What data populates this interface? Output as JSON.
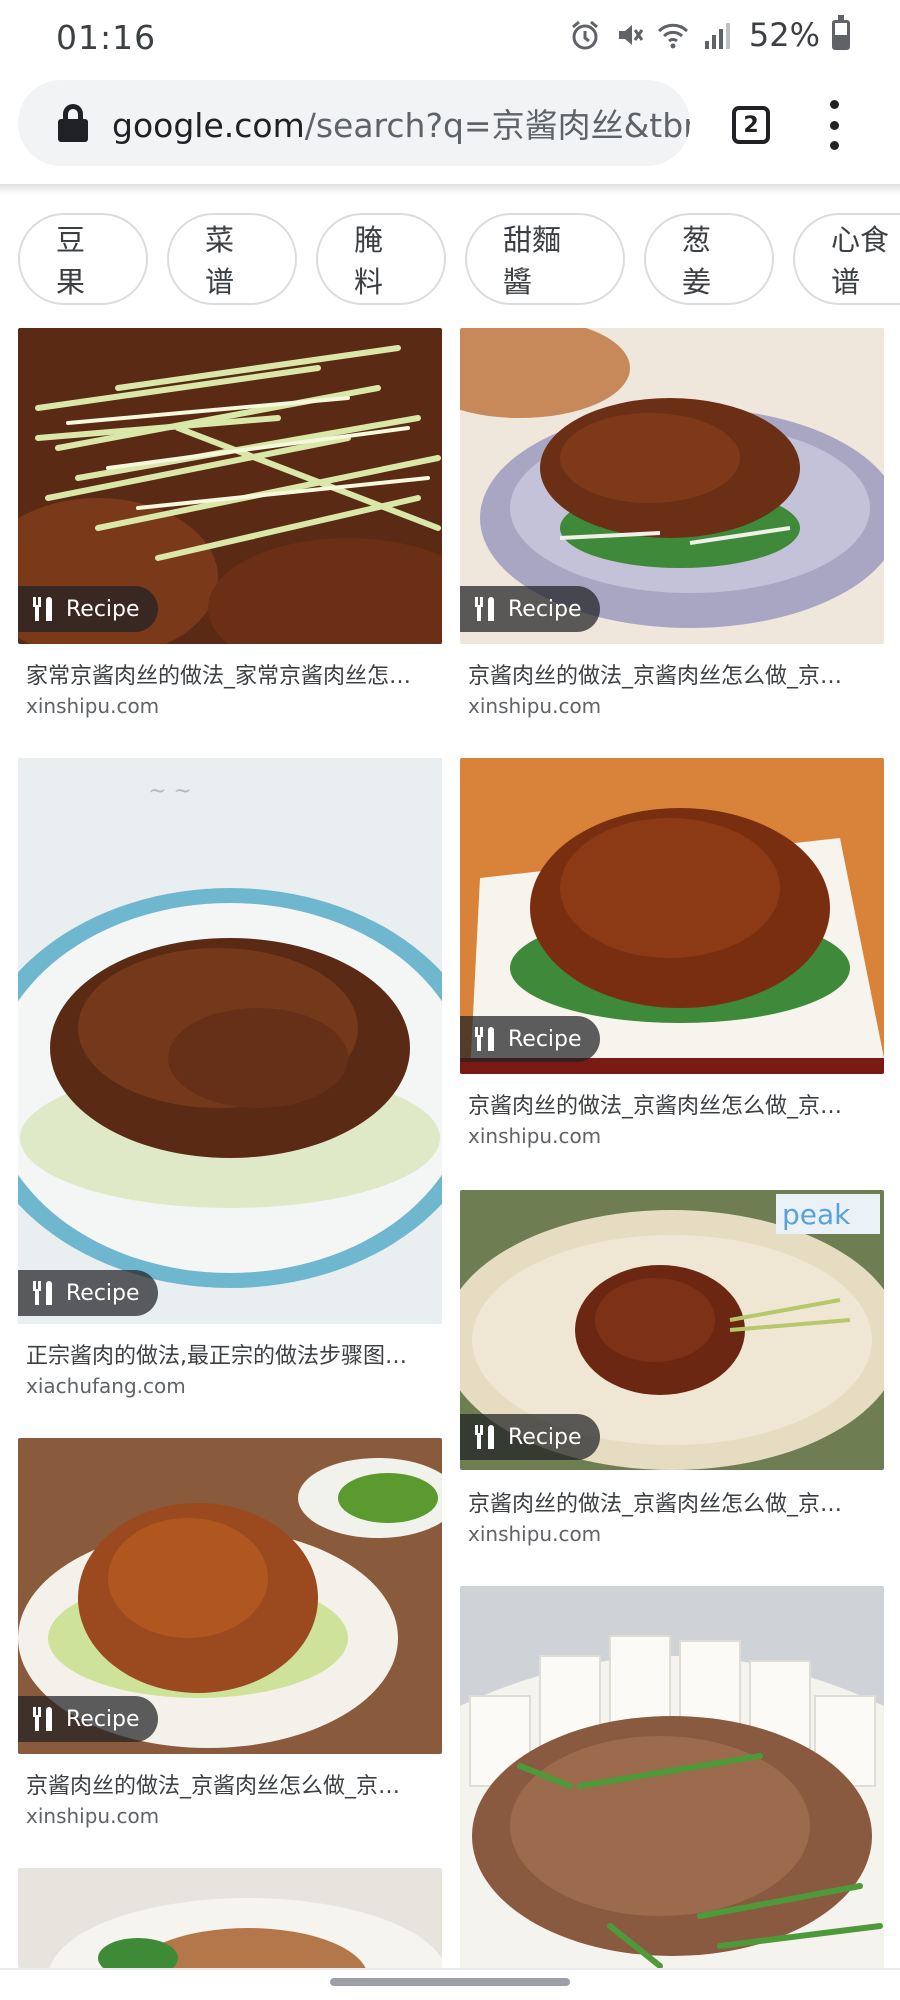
{
  "status_bar": {
    "time": "01:16",
    "battery_pct": "52%",
    "battery_level": 0.52,
    "icons": [
      "alarm-icon",
      "mute-icon",
      "wifi-icon",
      "signal-icon",
      "battery-icon"
    ]
  },
  "browser": {
    "url_host": "google.com",
    "url_rest": "/search?q=京酱肉丝&tbn",
    "tab_count": "2"
  },
  "chips": [
    "豆果",
    "菜谱",
    "腌料",
    "甜麵醬",
    "葱姜",
    "心食谱"
  ],
  "badge_label": "Recipe",
  "results": [
    {
      "title": "家常京酱肉丝的做法_家常京酱肉丝怎…",
      "source": "xinshipu.com"
    },
    {
      "title": "京酱肉丝的做法_京酱肉丝怎么做_京…",
      "source": "xinshipu.com"
    },
    {
      "title": "正宗酱肉的做法,最正宗的做法步骤图…",
      "source": "xiachufang.com"
    },
    {
      "title": "京酱肉丝的做法_京酱肉丝怎么做_京…",
      "source": "xinshipu.com"
    },
    {
      "title": "京酱肉丝的做法_京酱肉丝怎么做_京…",
      "source": "xinshipu.com"
    },
    {
      "title": "京酱肉丝的做法_京酱肉丝怎么做_京…",
      "source": "xinshipu.com"
    }
  ],
  "image_watermarks": [
    "peak"
  ],
  "colors": {
    "chip_border": "#dadce0",
    "omnibox_bg": "#f1f3f4",
    "source_text": "#5f6368"
  }
}
